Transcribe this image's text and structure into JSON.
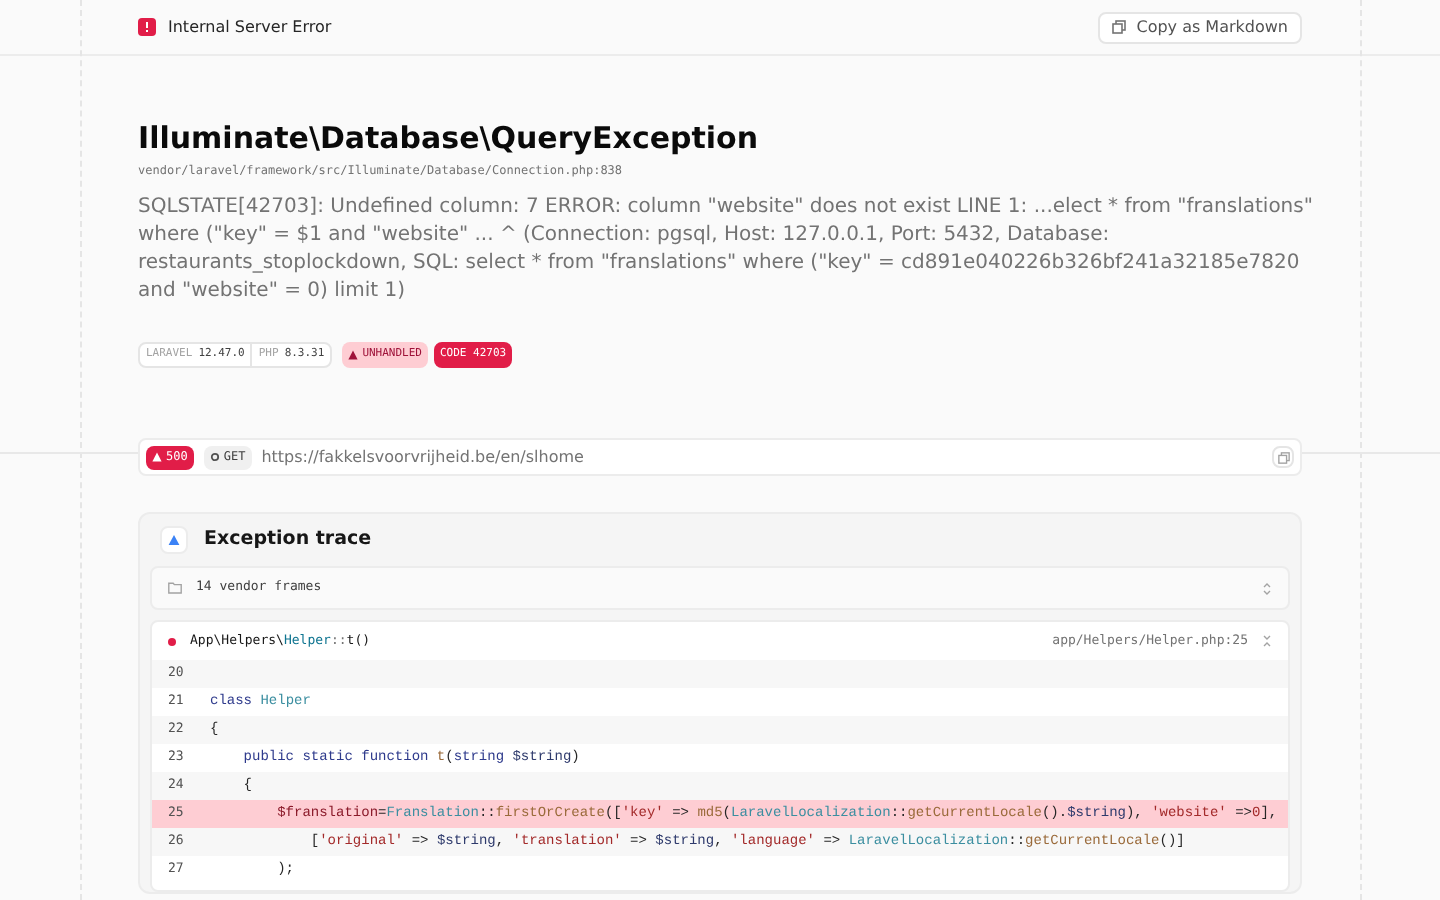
{
  "header": {
    "title": "Internal Server Error",
    "copy_button": "Copy as Markdown"
  },
  "exception": {
    "class": "Illuminate\\Database\\QueryException",
    "file": "vendor/laravel/framework/src/Illuminate/Database/Connection.php:838",
    "message": "SQLSTATE[42703]: Undefined column: 7 ERROR: column \"website\" does not exist LINE 1: ...elect * from \"franslations\" where (\"key\" = $1 and \"website\" ... ^ (Connection: pgsql, Host: 127.0.0.1, Port: 5432, Database: restaurants_stoplockdown, SQL: select * from \"franslations\" where (\"key\" = cd891e040226b326bf241a32185e7820 and \"website\" = 0) limit 1)",
    "badges": [
      {
        "kind": "version",
        "label": "LARAVEL",
        "value": "12.47.0"
      },
      {
        "kind": "version",
        "label": "PHP",
        "value": "8.3.31"
      },
      {
        "kind": "unhandled",
        "label": "UNHANDLED"
      },
      {
        "kind": "code",
        "label": "CODE 42703"
      }
    ]
  },
  "request": {
    "status": "500",
    "method": "GET",
    "url": "https://fakkelsvoorvrijheid.be/en/slhome"
  },
  "trace": {
    "title": "Exception trace",
    "vendor_frames": "14 vendor frames",
    "frame": {
      "ns": "App\\Helpers\\",
      "cls": "Helper",
      "sep": "::",
      "fn": "t()",
      "file": "app/Helpers/Helper.php:25",
      "lines": [
        {
          "number": "20",
          "highlighted": false
        },
        {
          "number": "21",
          "highlighted": false,
          "tokens": [
            {
              "text": "class ",
              "kind": "keyword"
            },
            {
              "text": "Helper",
              "kind": "class"
            }
          ]
        },
        {
          "number": "22",
          "highlighted": false,
          "tokens": [
            {
              "text": "{",
              "kind": "plain"
            }
          ]
        },
        {
          "number": "23",
          "highlighted": false,
          "tokens": [
            {
              "text": "    public static function ",
              "kind": "keyword"
            },
            {
              "text": "t",
              "kind": "function"
            },
            {
              "text": "(",
              "kind": "plain"
            },
            {
              "text": "string ",
              "kind": "keyword"
            },
            {
              "text": "$string",
              "kind": "variable"
            },
            {
              "text": ")",
              "kind": "plain"
            }
          ]
        },
        {
          "number": "24",
          "highlighted": false,
          "tokens": [
            {
              "text": "    {",
              "kind": "plain"
            }
          ]
        },
        {
          "number": "25",
          "highlighted": true,
          "tokens": [
            {
              "text": "        $franslation",
              "kind": "assigned"
            },
            {
              "text": "=",
              "kind": "plain"
            },
            {
              "text": "Franslation",
              "kind": "class"
            },
            {
              "text": "::",
              "kind": "plain"
            },
            {
              "text": "firstOrCreate",
              "kind": "function"
            },
            {
              "text": "([",
              "kind": "plain"
            },
            {
              "text": "'key'",
              "kind": "string"
            },
            {
              "text": " => ",
              "kind": "plain"
            },
            {
              "text": "md5",
              "kind": "function"
            },
            {
              "text": "(",
              "kind": "plain"
            },
            {
              "text": "LaravelLocalization",
              "kind": "class"
            },
            {
              "text": "::",
              "kind": "plain"
            },
            {
              "text": "getCurrentLocale",
              "kind": "function"
            },
            {
              "text": "().",
              "kind": "plain"
            },
            {
              "text": "$string",
              "kind": "variable"
            },
            {
              "text": "), ",
              "kind": "plain"
            },
            {
              "text": "'website'",
              "kind": "string"
            },
            {
              "text": " =>",
              "kind": "plain"
            },
            {
              "text": "0",
              "kind": "number"
            },
            {
              "text": "],",
              "kind": "plain"
            }
          ]
        },
        {
          "number": "26",
          "highlighted": false,
          "tokens": [
            {
              "text": "            [",
              "kind": "plain"
            },
            {
              "text": "'original'",
              "kind": "string"
            },
            {
              "text": " => ",
              "kind": "plain"
            },
            {
              "text": "$string",
              "kind": "variable"
            },
            {
              "text": ", ",
              "kind": "plain"
            },
            {
              "text": "'translation'",
              "kind": "string"
            },
            {
              "text": " => ",
              "kind": "plain"
            },
            {
              "text": "$string",
              "kind": "variable"
            },
            {
              "text": ", ",
              "kind": "plain"
            },
            {
              "text": "'language'",
              "kind": "string"
            },
            {
              "text": " => ",
              "kind": "plain"
            },
            {
              "text": "LaravelLocalization",
              "kind": "class"
            },
            {
              "text": "::",
              "kind": "plain"
            },
            {
              "text": "getCurrentLocale",
              "kind": "function"
            },
            {
              "text": "()]",
              "kind": "plain"
            }
          ]
        },
        {
          "number": "27",
          "highlighted": false,
          "tokens": [
            {
              "text": "        );",
              "kind": "plain"
            }
          ]
        }
      ]
    }
  }
}
